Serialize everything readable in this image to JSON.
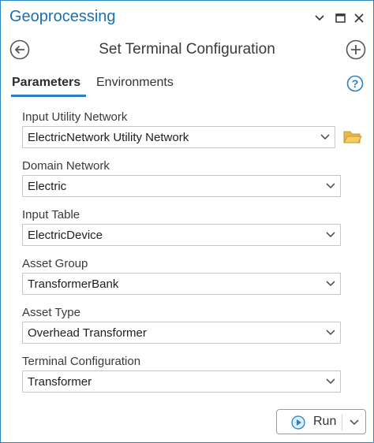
{
  "window": {
    "title": "Geoprocessing"
  },
  "tool": {
    "title": "Set Terminal Configuration"
  },
  "tabs": [
    {
      "label": "Parameters",
      "active": true
    },
    {
      "label": "Environments",
      "active": false
    }
  ],
  "parameters": [
    {
      "label": "Input Utility Network",
      "value": "ElectricNetwork Utility Network",
      "has_browse": true
    },
    {
      "label": "Domain Network",
      "value": "Electric"
    },
    {
      "label": "Input Table",
      "value": "ElectricDevice"
    },
    {
      "label": "Asset Group",
      "value": "TransformerBank"
    },
    {
      "label": "Asset Type",
      "value": "Overhead Transformer"
    },
    {
      "label": "Terminal Configuration",
      "value": "Transformer"
    }
  ],
  "run_button": {
    "label": "Run"
  },
  "icons": {
    "back": "back-arrow-icon",
    "add": "add-icon",
    "help": "help-icon",
    "browse": "folder-icon",
    "run": "play-icon",
    "dropdown": "chevron-down-icon"
  },
  "colors": {
    "accent": "#2a7fc1",
    "title": "#1f6fad",
    "folder": "#e8b84a",
    "border": "#2e86c8"
  }
}
